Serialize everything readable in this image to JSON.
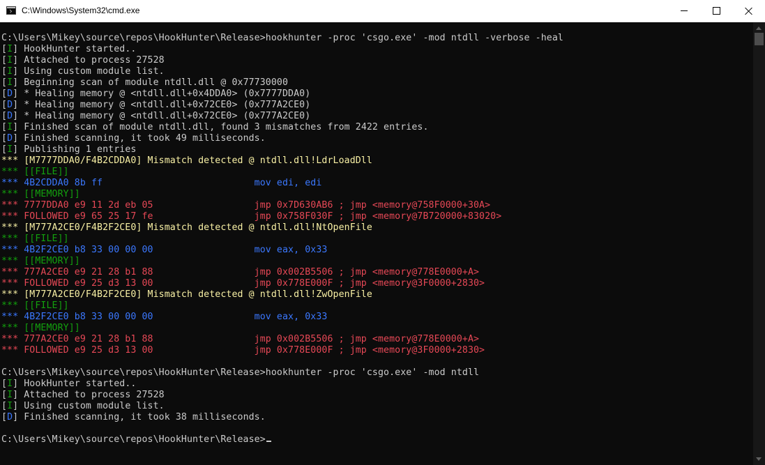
{
  "window": {
    "title": "C:\\Windows\\System32\\cmd.exe",
    "icon": "cmd-console-icon",
    "controls": {
      "minimize": "minimize-icon",
      "maximize": "maximize-icon",
      "close": "close-icon"
    }
  },
  "colors": {
    "background": "#0c0c0c",
    "default": "#cccccc",
    "green": "#13a10e",
    "blue": "#3b78ff",
    "yellow": "#f9f1a5",
    "red": "#e74856"
  },
  "lines": [
    [
      {
        "t": "C:\\Users\\Mikey\\source\\repos\\HookHunter\\Release>hookhunter -proc 'csgo.exe' -mod ntdll -verbose -heal",
        "c": "#cccccc"
      }
    ],
    [
      {
        "t": "[",
        "c": "#cccccc"
      },
      {
        "t": "I",
        "c": "#13a10e"
      },
      {
        "t": "] HookHunter started..",
        "c": "#cccccc"
      }
    ],
    [
      {
        "t": "[",
        "c": "#cccccc"
      },
      {
        "t": "I",
        "c": "#13a10e"
      },
      {
        "t": "] Attached to process 27528",
        "c": "#cccccc"
      }
    ],
    [
      {
        "t": "[",
        "c": "#cccccc"
      },
      {
        "t": "I",
        "c": "#13a10e"
      },
      {
        "t": "] Using custom module list.",
        "c": "#cccccc"
      }
    ],
    [
      {
        "t": "[",
        "c": "#cccccc"
      },
      {
        "t": "I",
        "c": "#13a10e"
      },
      {
        "t": "] Beginning scan of module ntdll.dll @ 0x77730000",
        "c": "#cccccc"
      }
    ],
    [
      {
        "t": "[",
        "c": "#cccccc"
      },
      {
        "t": "D",
        "c": "#3b78ff"
      },
      {
        "t": "] * Healing memory @ <ntdll.dll+0x4DDA0> (0x7777DDA0)",
        "c": "#cccccc"
      }
    ],
    [
      {
        "t": "[",
        "c": "#cccccc"
      },
      {
        "t": "D",
        "c": "#3b78ff"
      },
      {
        "t": "] * Healing memory @ <ntdll.dll+0x72CE0> (0x777A2CE0)",
        "c": "#cccccc"
      }
    ],
    [
      {
        "t": "[",
        "c": "#cccccc"
      },
      {
        "t": "D",
        "c": "#3b78ff"
      },
      {
        "t": "] * Healing memory @ <ntdll.dll+0x72CE0> (0x777A2CE0)",
        "c": "#cccccc"
      }
    ],
    [
      {
        "t": "[",
        "c": "#cccccc"
      },
      {
        "t": "I",
        "c": "#13a10e"
      },
      {
        "t": "] Finished scan of module ntdll.dll, found 3 mismatches from 2422 entries.",
        "c": "#cccccc"
      }
    ],
    [
      {
        "t": "[",
        "c": "#cccccc"
      },
      {
        "t": "D",
        "c": "#3b78ff"
      },
      {
        "t": "] Finished scanning, it took 49 milliseconds.",
        "c": "#cccccc"
      }
    ],
    [
      {
        "t": "[",
        "c": "#cccccc"
      },
      {
        "t": "I",
        "c": "#13a10e"
      },
      {
        "t": "] Publishing 1 entries",
        "c": "#cccccc"
      }
    ],
    [
      {
        "t": "*** [M7777DDA0/F4B2CDDA0] Mismatch detected @ ntdll.dll!LdrLoadDll",
        "c": "#f9f1a5"
      }
    ],
    [
      {
        "t": "*** [[FILE]]",
        "c": "#13a10e"
      }
    ],
    [
      {
        "t": "*** 4B2CDDA0 8b ff                           mov edi, edi",
        "c": "#3b78ff"
      }
    ],
    [
      {
        "t": "*** [[MEMORY]]",
        "c": "#13a10e"
      }
    ],
    [
      {
        "t": "*** 7777DDA0 e9 11 2d eb 05                  jmp 0x7D630AB6 ; jmp <memory@758F0000+30A>",
        "c": "#e74856"
      }
    ],
    [
      {
        "t": "*** FOLLOWED e9 65 25 17 fe                  jmp 0x758F030F ; jmp <memory@7B720000+83020>",
        "c": "#e74856"
      }
    ],
    [
      {
        "t": "*** [M777A2CE0/F4B2F2CE0] Mismatch detected @ ntdll.dll!NtOpenFile",
        "c": "#f9f1a5"
      }
    ],
    [
      {
        "t": "*** [[FILE]]",
        "c": "#13a10e"
      }
    ],
    [
      {
        "t": "*** 4B2F2CE0 b8 33 00 00 00                  mov eax, 0x33",
        "c": "#3b78ff"
      }
    ],
    [
      {
        "t": "*** [[MEMORY]]",
        "c": "#13a10e"
      }
    ],
    [
      {
        "t": "*** 777A2CE0 e9 21 28 b1 88                  jmp 0x002B5506 ; jmp <memory@778E0000+A>",
        "c": "#e74856"
      }
    ],
    [
      {
        "t": "*** FOLLOWED e9 25 d3 13 00                  jmp 0x778E000F ; jmp <memory@3F0000+2830>",
        "c": "#e74856"
      }
    ],
    [
      {
        "t": "*** [M777A2CE0/F4B2F2CE0] Mismatch detected @ ntdll.dll!ZwOpenFile",
        "c": "#f9f1a5"
      }
    ],
    [
      {
        "t": "*** [[FILE]]",
        "c": "#13a10e"
      }
    ],
    [
      {
        "t": "*** 4B2F2CE0 b8 33 00 00 00                  mov eax, 0x33",
        "c": "#3b78ff"
      }
    ],
    [
      {
        "t": "*** [[MEMORY]]",
        "c": "#13a10e"
      }
    ],
    [
      {
        "t": "*** 777A2CE0 e9 21 28 b1 88                  jmp 0x002B5506 ; jmp <memory@778E0000+A>",
        "c": "#e74856"
      }
    ],
    [
      {
        "t": "*** FOLLOWED e9 25 d3 13 00                  jmp 0x778E000F ; jmp <memory@3F0000+2830>",
        "c": "#e74856"
      }
    ],
    [],
    [
      {
        "t": "C:\\Users\\Mikey\\source\\repos\\HookHunter\\Release>hookhunter -proc 'csgo.exe' -mod ntdll",
        "c": "#cccccc"
      }
    ],
    [
      {
        "t": "[",
        "c": "#cccccc"
      },
      {
        "t": "I",
        "c": "#13a10e"
      },
      {
        "t": "] HookHunter started..",
        "c": "#cccccc"
      }
    ],
    [
      {
        "t": "[",
        "c": "#cccccc"
      },
      {
        "t": "I",
        "c": "#13a10e"
      },
      {
        "t": "] Attached to process 27528",
        "c": "#cccccc"
      }
    ],
    [
      {
        "t": "[",
        "c": "#cccccc"
      },
      {
        "t": "I",
        "c": "#13a10e"
      },
      {
        "t": "] Using custom module list.",
        "c": "#cccccc"
      }
    ],
    [
      {
        "t": "[",
        "c": "#cccccc"
      },
      {
        "t": "D",
        "c": "#3b78ff"
      },
      {
        "t": "] Finished scanning, it took 38 milliseconds.",
        "c": "#cccccc"
      }
    ],
    [],
    [
      {
        "t": "C:\\Users\\Mikey\\source\\repos\\HookHunter\\Release>",
        "c": "#cccccc"
      }
    ]
  ]
}
